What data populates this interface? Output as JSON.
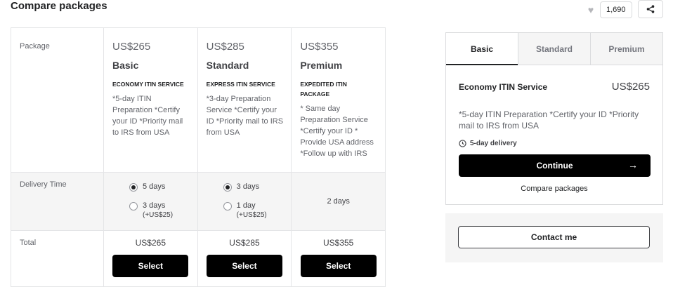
{
  "header": {
    "title": "Compare packages",
    "likes": "1,690"
  },
  "icons": {
    "like": "heart-icon",
    "share": "share-icon",
    "clock": "clock-icon",
    "arrow": "arrow-right-icon"
  },
  "table": {
    "row_labels": {
      "package": "Package",
      "delivery": "Delivery Time",
      "total": "Total"
    },
    "packages": [
      {
        "price": "US$265",
        "name": "Basic",
        "subtitle": "ECONOMY ITIN SERVICE",
        "description": "*5-day ITIN Preparation *Certify your ID *Priority mail to IRS from USA",
        "total": "US$265",
        "select": "Select",
        "delivery": [
          {
            "label": "5 days",
            "extra": "",
            "selected": true
          },
          {
            "label": "3 days",
            "extra": "(+US$25)",
            "selected": false
          }
        ]
      },
      {
        "price": "US$285",
        "name": "Standard",
        "subtitle": "EXPRESS ITIN SERVICE",
        "description": "*3-day Preparation Service *Certify your ID *Priority mail to IRS from USA",
        "total": "US$285",
        "select": "Select",
        "delivery": [
          {
            "label": "3 days",
            "extra": "",
            "selected": true
          },
          {
            "label": "1 day",
            "extra": "(+US$25)",
            "selected": false
          }
        ]
      },
      {
        "price": "US$355",
        "name": "Premium",
        "subtitle": "EXPEDITED ITIN PACKAGE",
        "description": "* Same day Preparation Service *Certify your ID * Provide USA address *Follow up with IRS",
        "total": "US$355",
        "select": "Select",
        "delivery_text": "2 days"
      }
    ]
  },
  "panel": {
    "tabs": [
      "Basic",
      "Standard",
      "Premium"
    ],
    "active_tab": "Basic",
    "service_name": "Economy ITIN Service",
    "price": "US$265",
    "description": "*5-day ITIN Preparation *Certify your ID *Priority mail to IRS from USA",
    "delivery": "5-day delivery",
    "continue": "Continue",
    "compare_link": "Compare packages"
  },
  "contact": {
    "label": "Contact me"
  }
}
